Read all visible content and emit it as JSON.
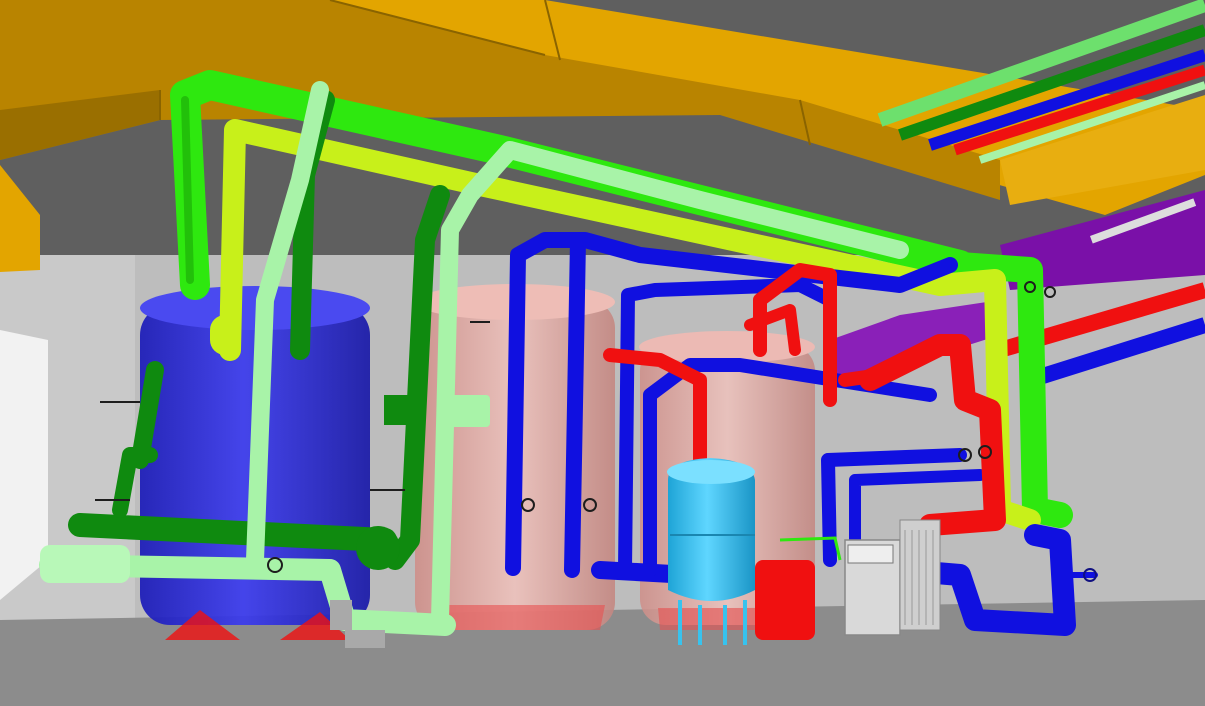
{
  "scene": {
    "type": "3d-mep-piping-model",
    "visible_text": [],
    "colors": {
      "ceiling": "#5d5d5d",
      "wall": "#bdbdbd",
      "floor": "#8d8d8d",
      "duct_yellow": "#e3a500",
      "duct_yellow_dark": "#b98400",
      "duct_purple": "#7a10a8",
      "pipe_green": "#2ee80f",
      "pipe_dark_green": "#0f8a0f",
      "pipe_light_green": "#a8f3a8",
      "pipe_lime": "#c8f01a",
      "pipe_blue": "#1010e0",
      "pipe_red": "#f01010",
      "tank_blue": "#2a2adc",
      "tank_pink": "#e6aaa3",
      "expansion_vessel": "#37c3ee",
      "pump_gray": "#d9d9d9"
    },
    "components": [
      {
        "id": "supply-duct",
        "kind": "duct",
        "color": "duct_yellow"
      },
      {
        "id": "exhaust-duct",
        "kind": "duct",
        "color": "duct_purple"
      },
      {
        "id": "storage-tank-1",
        "kind": "tank",
        "color": "tank_blue"
      },
      {
        "id": "storage-tank-2",
        "kind": "tank",
        "color": "tank_pink"
      },
      {
        "id": "storage-tank-3",
        "kind": "tank",
        "color": "tank_pink"
      },
      {
        "id": "expansion-vessel",
        "kind": "vessel",
        "color": "expansion_vessel"
      },
      {
        "id": "heat-exchanger",
        "kind": "equipment",
        "color": "pump_gray"
      },
      {
        "id": "circulation-pumps",
        "kind": "pump",
        "color": "pipe_light_green"
      }
    ],
    "pipe_runs": [
      "pipe_green",
      "pipe_dark_green",
      "pipe_light_green",
      "pipe_lime",
      "pipe_blue",
      "pipe_red"
    ]
  }
}
